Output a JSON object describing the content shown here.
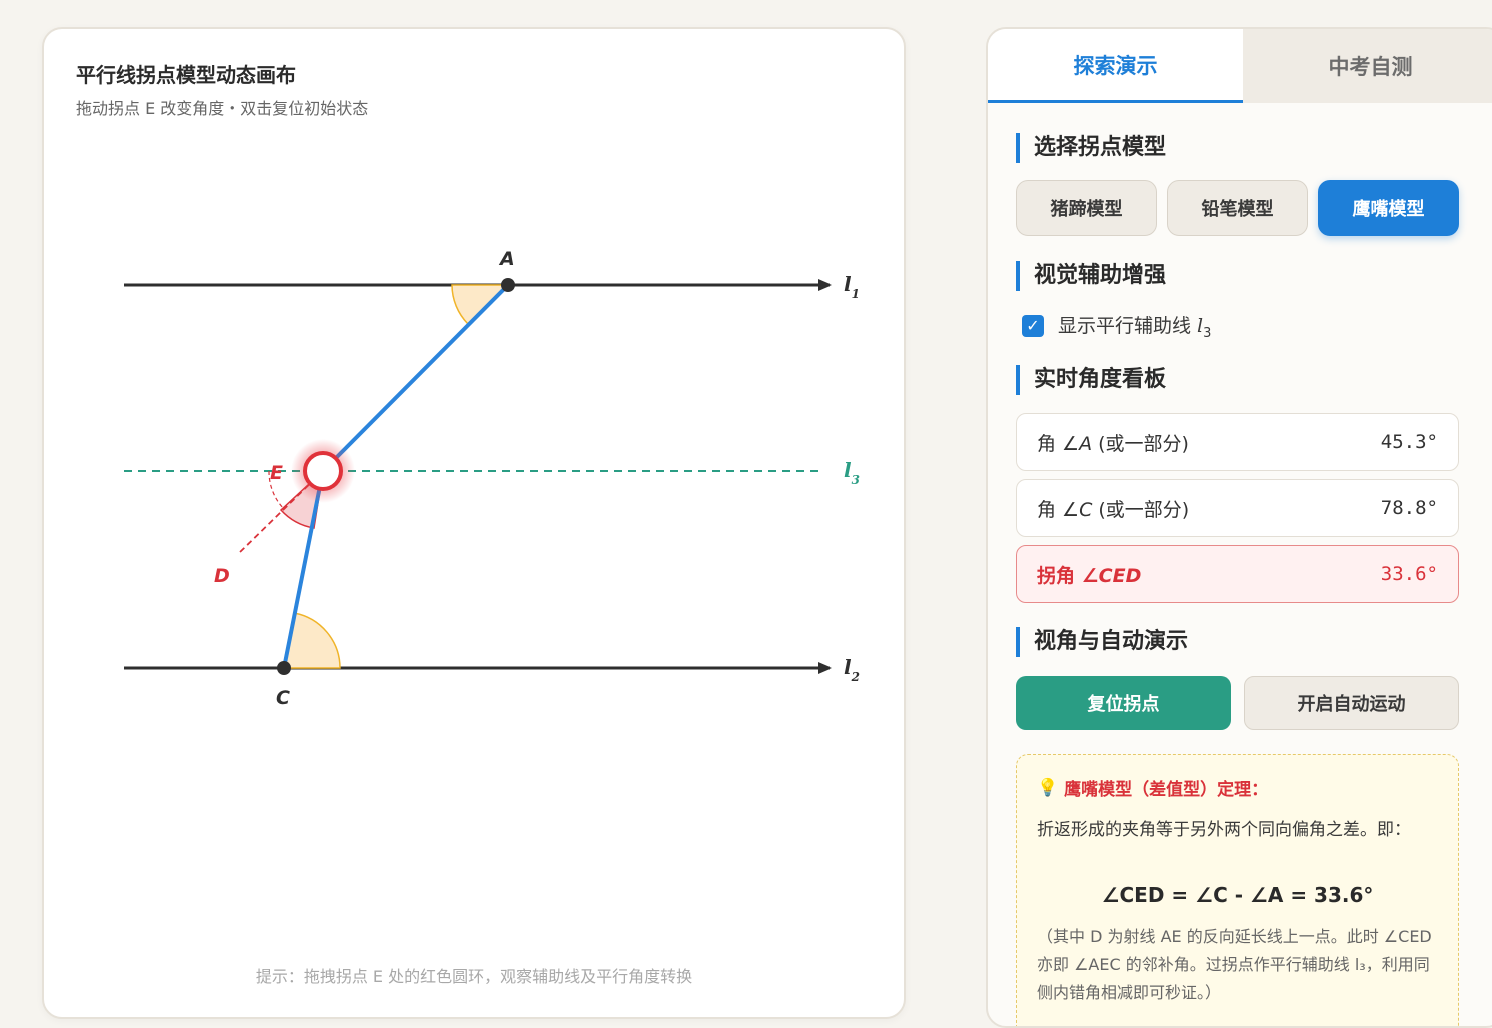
{
  "canvas": {
    "title": "平行线拐点模型动态画布",
    "subtitle": "拖动拐点 E 改变角度・双击复位初始状态",
    "hint": "提示：拖拽拐点 E 处的红色圆环，观察辅助线及平行角度转换",
    "labels": {
      "A": "A",
      "C": "C",
      "D": "D",
      "E": "E",
      "l1": "l",
      "l1_sub": "1",
      "l2": "l",
      "l2_sub": "2",
      "l3": "l",
      "l3_sub": "3"
    }
  },
  "tabs": [
    {
      "label": "探索演示",
      "active": true
    },
    {
      "label": "中考自测",
      "active": false
    }
  ],
  "sections": {
    "model": "选择拐点模型",
    "visual": "视觉辅助增强",
    "dashboard": "实时角度看板",
    "view": "视角与自动演示"
  },
  "models": [
    {
      "label": "猪蹄模型",
      "active": false
    },
    {
      "label": "铅笔模型",
      "active": false
    },
    {
      "label": "鹰嘴模型",
      "active": true
    }
  ],
  "aux_line": {
    "checked": true,
    "label": "显示平行辅助线 ",
    "var": "l",
    "sub": "3"
  },
  "angles": [
    {
      "label_pre": "角 ∠",
      "label_var": "A",
      "label_post": " (或一部分)",
      "value": "45.3°"
    },
    {
      "label_pre": "角 ∠",
      "label_var": "C",
      "label_post": " (或一部分)",
      "value": "78.8°"
    },
    {
      "label_pre": "拐角 ∠",
      "label_var": "CED",
      "label_post": "",
      "value": "33.6°"
    }
  ],
  "actions": {
    "reset": "复位拐点",
    "auto": "开启自动运动"
  },
  "theorem": {
    "title": "鹰嘴模型（差值型）定理：",
    "body": "折返形成的夹角等于另外两个同向偏角之差。即：",
    "formula": "∠CED = ∠C - ∠A = 33.6°",
    "note": "（其中 D 为射线 AE 的反向延长线上一点。此时 ∠CED 亦即 ∠AEC 的邻补角。过拐点作平行辅助线 l₃，利用同侧内错角相减即可秒证。）"
  },
  "colors": {
    "accent": "#1e7fd8",
    "segment": "#2b84dc",
    "aux": "#2a9d84",
    "danger": "#d9323a",
    "arc_fill": "#fde9c8",
    "arc_stroke": "#f0b429"
  }
}
